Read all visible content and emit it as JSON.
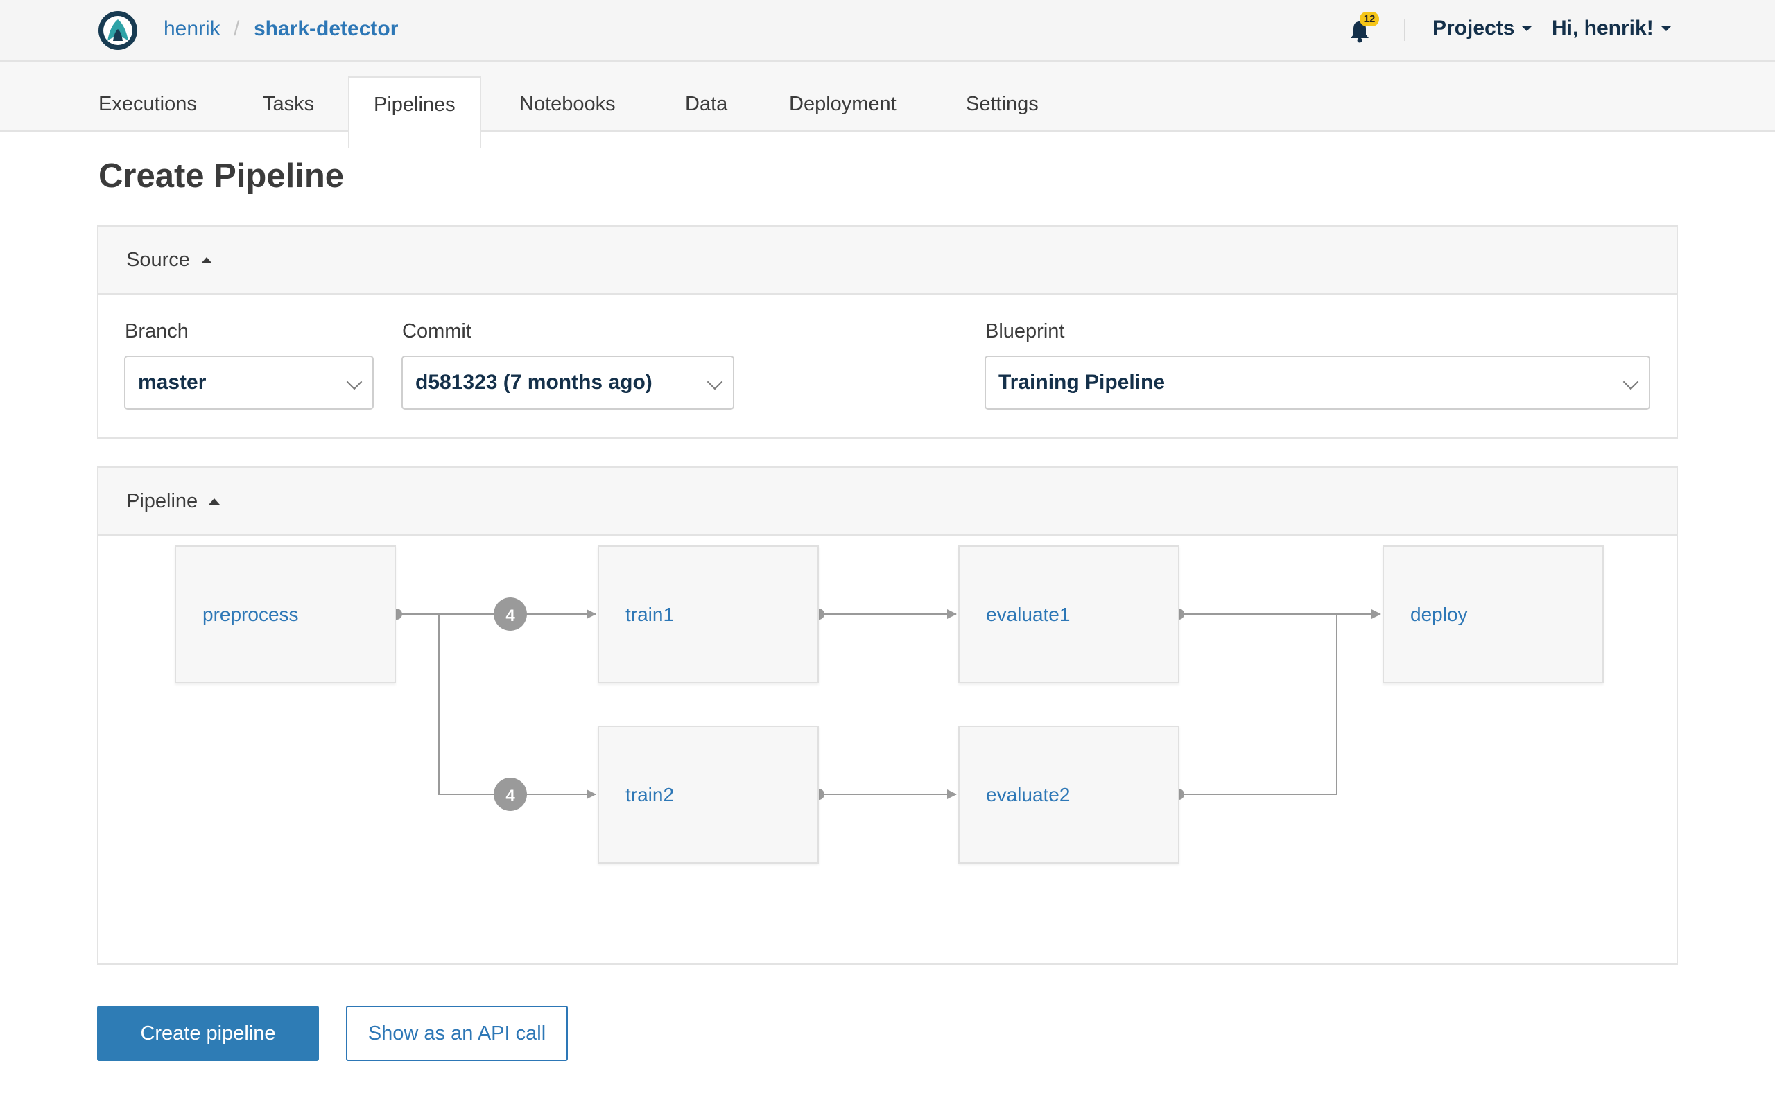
{
  "header": {
    "breadcrumb_owner": "henrik",
    "breadcrumb_separator": "/",
    "breadcrumb_project": "shark-detector",
    "notification_count": "12",
    "projects_label": "Projects",
    "user_greeting": "Hi, henrik!"
  },
  "tabs": [
    {
      "label": "Executions"
    },
    {
      "label": "Tasks"
    },
    {
      "label": "Pipelines"
    },
    {
      "label": "Notebooks"
    },
    {
      "label": "Data"
    },
    {
      "label": "Deployment"
    },
    {
      "label": "Settings"
    }
  ],
  "active_tab": "Pipelines",
  "page": {
    "title": "Create Pipeline"
  },
  "source": {
    "heading": "Source",
    "branch_label": "Branch",
    "branch_value": "master",
    "commit_label": "Commit",
    "commit_value": "d581323 (7 months ago)",
    "blueprint_label": "Blueprint",
    "blueprint_value": "Training Pipeline"
  },
  "pipeline": {
    "heading": "Pipeline",
    "nodes": [
      {
        "label": "preprocess"
      },
      {
        "label": "train1"
      },
      {
        "label": "evaluate1"
      },
      {
        "label": "deploy"
      },
      {
        "label": "train2"
      },
      {
        "label": "evaluate2"
      }
    ],
    "edge_badges": [
      "4",
      "4"
    ]
  },
  "actions": {
    "create_label": "Create pipeline",
    "api_label": "Show as an API call"
  },
  "colors": {
    "link": "#2d77b6",
    "primary_button": "#2e7cb5",
    "badge": "#f5c518",
    "nav_text": "#14304a"
  }
}
